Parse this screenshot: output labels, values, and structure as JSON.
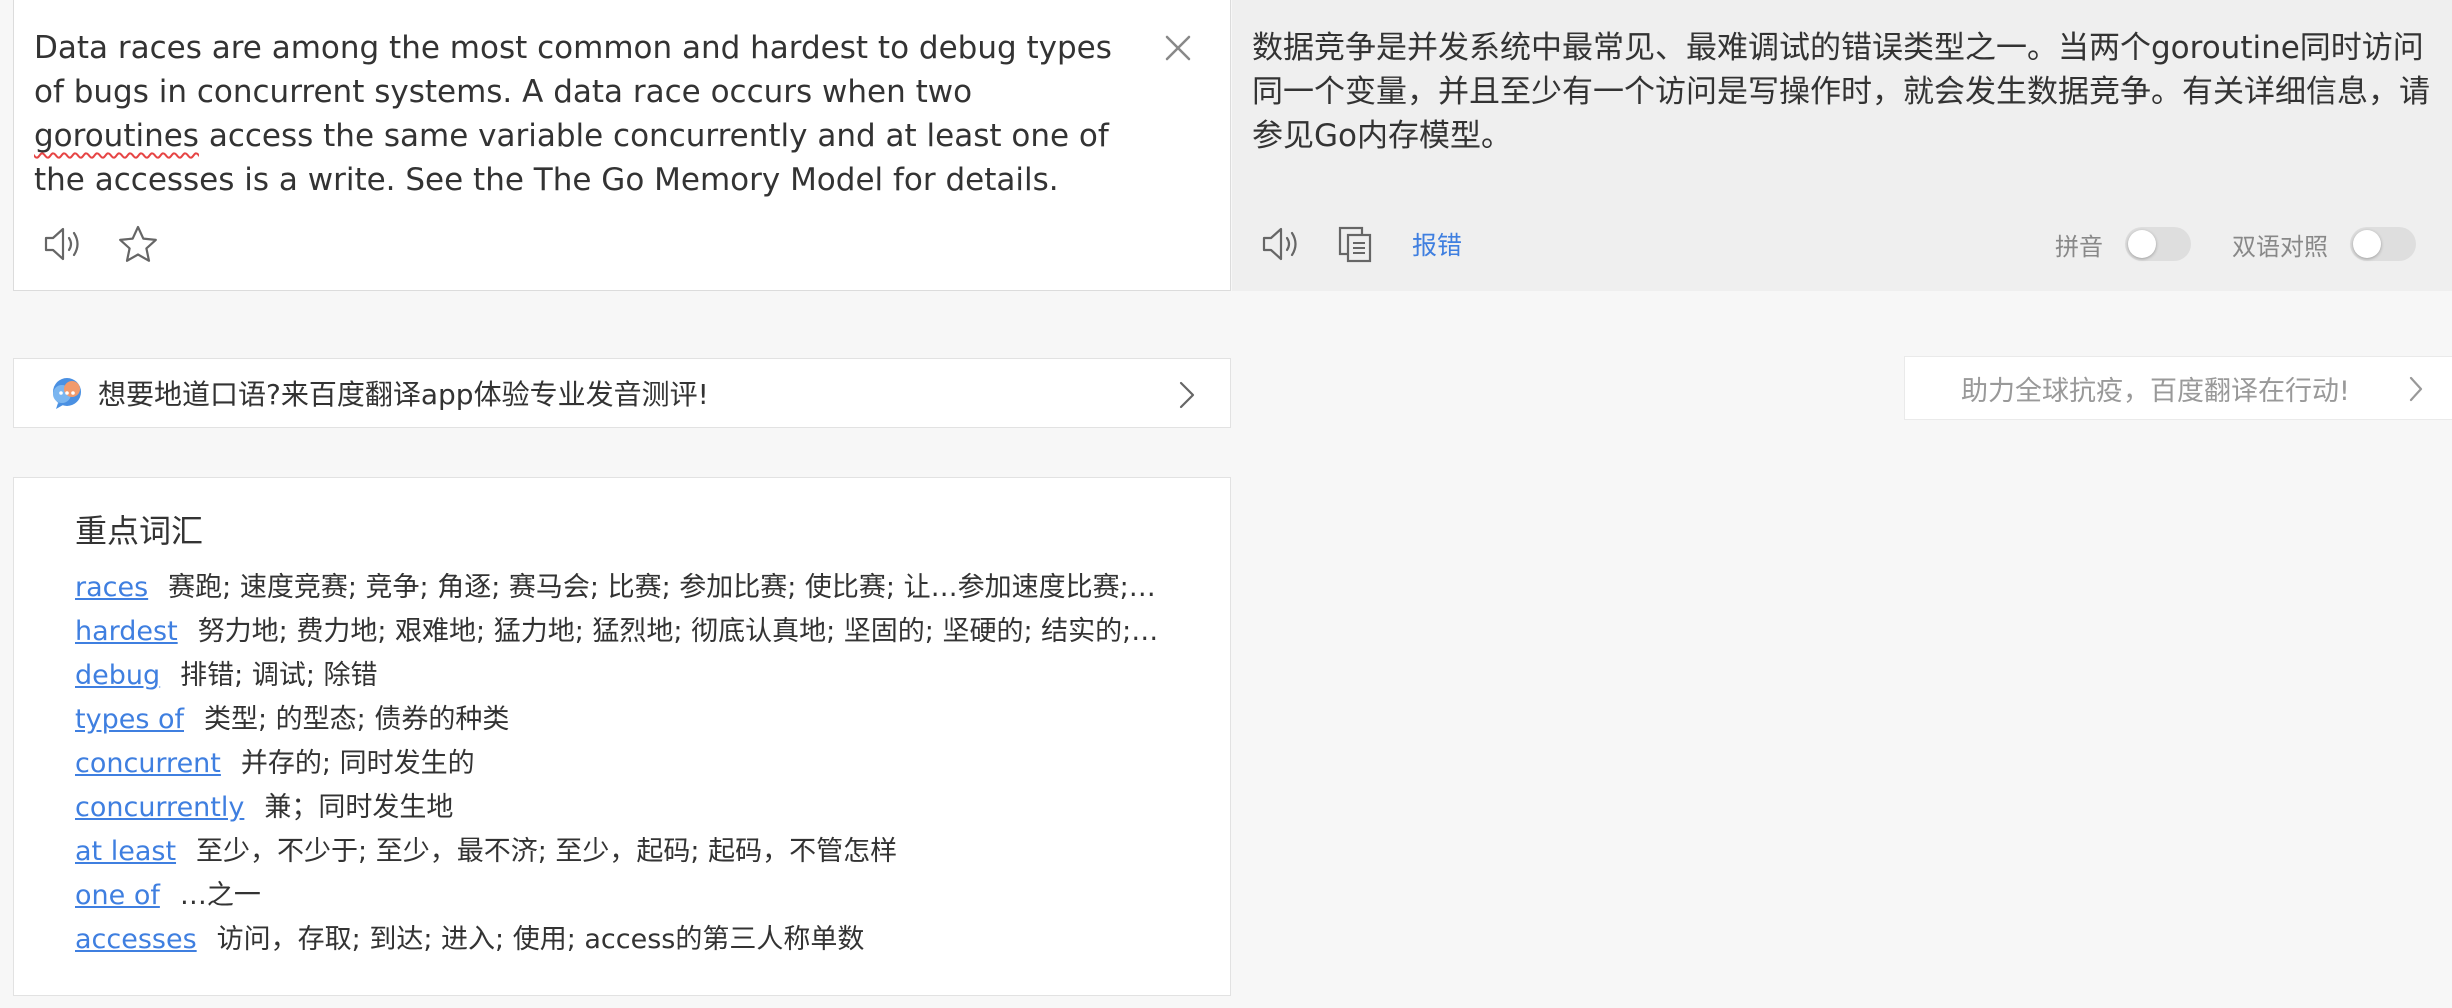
{
  "source": {
    "text_before": "Data races are among the most common and hardest to debug types of bugs in concurrent systems. A data race occurs when two ",
    "text_flagged": "goroutines",
    "text_after": " access the same variable concurrently and at least one of the accesses is a write. See the The Go Memory Model for details."
  },
  "target": {
    "text": "数据竞争是并发系统中最常见、最难调试的错误类型之一。当两个goroutine同时访问同一个变量，并且至少有一个访问是写操作时，就会发生数据竞争。有关详细信息，请参见Go内存模型。",
    "report_label": "报错",
    "pinyin_label": "拼音",
    "bilingual_label": "双语对照",
    "pinyin_on": false,
    "bilingual_on": false
  },
  "promo": {
    "text": "想要地道口语?来百度翻译app体验专业发音测评!"
  },
  "notice": {
    "text": "助力全球抗疫，百度翻译在行动!"
  },
  "vocab": {
    "title": "重点词汇",
    "items": [
      {
        "word": "races",
        "def": "赛跑; 速度竞赛; 竞争; 角逐; 赛马会; 比赛; 参加比赛; 使比赛; 让…参加速度比赛;…"
      },
      {
        "word": "hardest",
        "def": "努力地; 费力地; 艰难地; 猛力地; 猛烈地; 彻底认真地; 坚固的; 坚硬的; 结实的;…"
      },
      {
        "word": "debug",
        "def": "排错; 调试; 除错"
      },
      {
        "word": "types of",
        "def": "类型; 的型态; 债券的种类"
      },
      {
        "word": "concurrent",
        "def": "并存的; 同时发生的"
      },
      {
        "word": "concurrently",
        "def": "兼；同时发生地"
      },
      {
        "word": "at least",
        "def": "至少，不少于; 至少，最不济; 至少，起码; 起码，不管怎样"
      },
      {
        "word": "one of",
        "def": "…之一"
      },
      {
        "word": "accesses",
        "def": "访问，存取; 到达; 进入; 使用; access的第三人称单数"
      }
    ]
  },
  "colors": {
    "link": "#3f7fe0",
    "page_bg": "#f7f7f7",
    "target_bg": "#efefef"
  }
}
